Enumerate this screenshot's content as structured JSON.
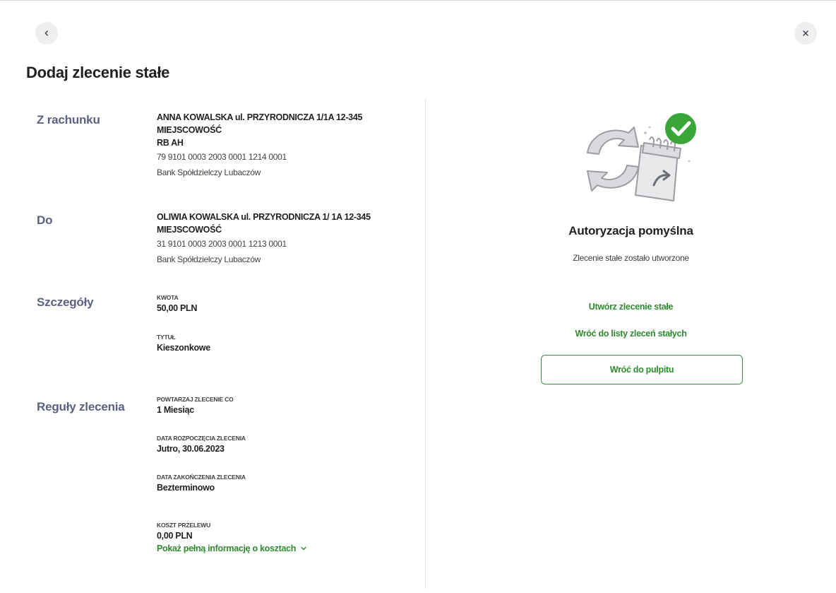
{
  "page": {
    "title": "Dodaj zlecenie stałe"
  },
  "nav": {
    "back_icon": "chevron-left-icon",
    "close_icon": "close-icon"
  },
  "from": {
    "label": "Z rachunku",
    "name_line1": "ANNA KOWALSKA ul. PRZYRODNICZA 1/1A 12-345",
    "name_line2": "MIEJSCOWOŚĆ",
    "account_name": "RB AH",
    "account_number": "79 9101 0003 2003 0001 1214 0001",
    "bank": "Bank Spółdzielczy Lubaczów"
  },
  "to": {
    "label": "Do",
    "name_line1": "OLIWIA KOWALSKA ul. PRZYRODNICZA 1/ 1A 12-345",
    "name_line2": "MIEJSCOWOŚĆ",
    "account_number": "31 9101 0003 2003 0001 1213 0001",
    "bank": "Bank Spółdzielczy Lubaczów"
  },
  "details": {
    "label": "Szczegóły",
    "amount_caption": "KWOTA",
    "amount_value": "50,00 PLN",
    "title_caption": "TYTUŁ",
    "title_value": "Kieszonkowe"
  },
  "rules": {
    "label": "Reguły zlecenia",
    "repeat_caption": "POWTARZAJ ZLECENIE CO",
    "repeat_value": "1 Miesiąc",
    "start_caption": "DATA ROZPOCZĘCIA ZLECENIA",
    "start_value": "Jutro, 30.06.2023",
    "end_caption": "DATA ZAKOŃCZENIA ZLECENIA",
    "end_value": "Bezterminowo",
    "cost_caption": "KOSZT PRZELEWU",
    "cost_value": "0,00 PLN",
    "cost_link": "Pokaż pełną informację o kosztach"
  },
  "result": {
    "title": "Autoryzacja pomyślna",
    "subtitle": "Zlecenie stałe zostało utworzone",
    "link_create": "Utwórz zlecenie stałe",
    "link_back_list": "Wróć do listy zleceń stałych",
    "button_dashboard": "Wróć do pulpitu"
  },
  "colors": {
    "accent_green": "#2e8b2e",
    "success_badge": "#3aa63a",
    "section_label": "#5a6280"
  }
}
